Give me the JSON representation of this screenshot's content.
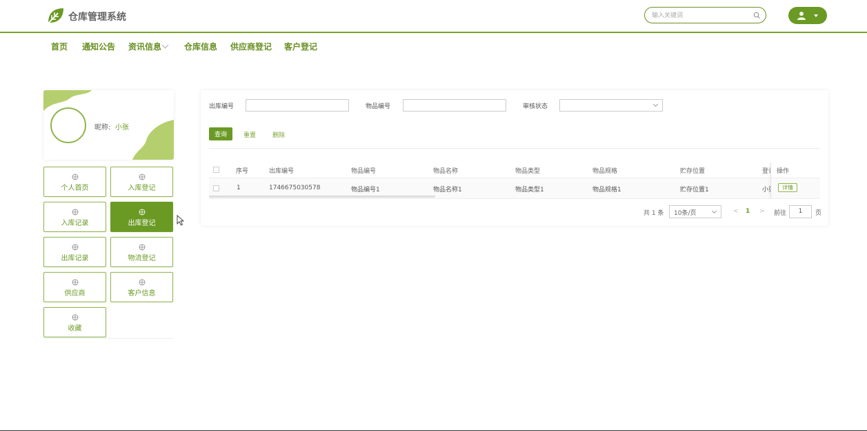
{
  "header": {
    "app_title": "仓库管理系统",
    "search_placeholder": "输入关键词",
    "accent": "#6a9a24"
  },
  "nav": {
    "items": [
      {
        "label": "首页"
      },
      {
        "label": "通知公告"
      },
      {
        "label": "资讯信息"
      },
      {
        "label": "仓库信息"
      },
      {
        "label": "供应商登记"
      },
      {
        "label": "客户登记"
      }
    ]
  },
  "profile": {
    "nick_label": "昵称:",
    "nick_value": "小张"
  },
  "side_menu": {
    "items": [
      {
        "label": "个人首页",
        "icon": "grid-icon"
      },
      {
        "label": "入库登记",
        "icon": "grid-icon"
      },
      {
        "label": "入库记录",
        "icon": "grid-icon"
      },
      {
        "label": "出库登记",
        "icon": "grid-icon",
        "active": true
      },
      {
        "label": "出库记录",
        "icon": "grid-icon"
      },
      {
        "label": "物流登记",
        "icon": "grid-icon"
      },
      {
        "label": "供应商",
        "icon": "grid-icon"
      },
      {
        "label": "客户信息",
        "icon": "grid-icon"
      },
      {
        "label": "收藏",
        "icon": "grid-icon"
      }
    ]
  },
  "filters": {
    "outbound_no_label": "出库编号",
    "outbound_no_value": "",
    "item_no_label": "物品编号",
    "item_no_value": "",
    "audit_label": "审核状态",
    "audit_value": ""
  },
  "actions": {
    "query": "查询",
    "reset": "重置",
    "delete": "删除"
  },
  "table": {
    "columns": [
      "序号",
      "出库编号",
      "物品编号",
      "物品名称",
      "物品类型",
      "物品规格",
      "贮存位置",
      "登记",
      "操作"
    ],
    "rows": [
      {
        "index": "1",
        "outbound_no": "1746675030578",
        "item_no": "物品编号1",
        "item_name": "物品名称1",
        "item_type": "物品类型1",
        "item_spec": "物品规格1",
        "storage": "贮存位置1",
        "registrar": "小张",
        "detail": "详情"
      }
    ]
  },
  "pagination": {
    "total": "共 1 条",
    "page_size": "10条/页",
    "prev": "<",
    "current": "1",
    "next": ">",
    "goto": "前往",
    "goto_value": "1",
    "page_suffix": "页"
  }
}
